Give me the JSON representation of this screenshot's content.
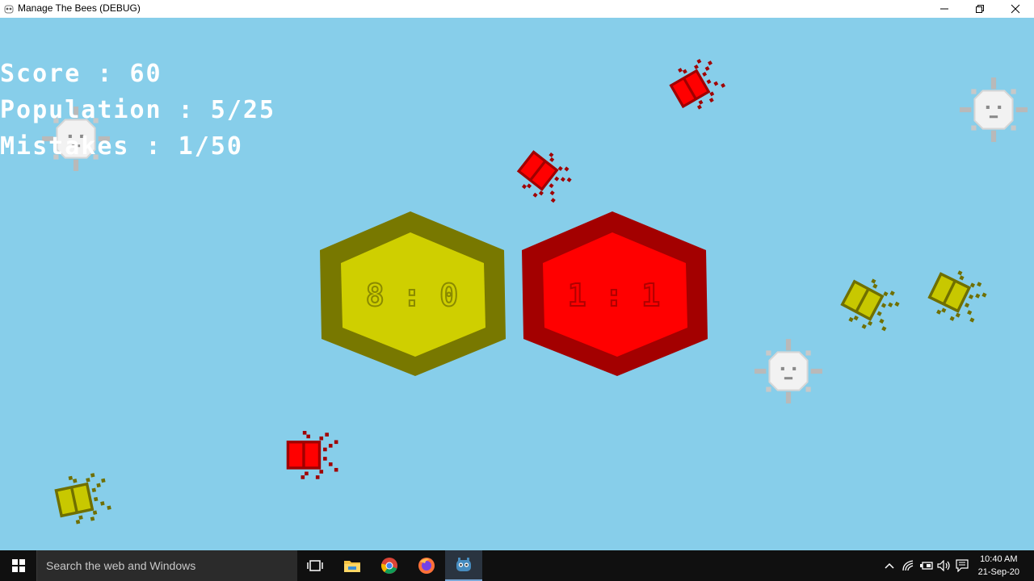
{
  "window": {
    "title": "Manage The Bees (DEBUG)",
    "app_icon": "godot-icon",
    "controls": [
      "minimize-icon",
      "restore-icon",
      "close-icon"
    ]
  },
  "hud": {
    "score": "Score : 60",
    "population": "Population : 5/25",
    "mistakes": "Mistakes : 1/50"
  },
  "hives": [
    {
      "color": "yellow",
      "label": "8 : 0",
      "outer": "#787800",
      "inner": "#cfcf00",
      "text": "#8a8a00"
    },
    {
      "color": "red",
      "label": "1 : 1",
      "outer": "#a30000",
      "inner": "#ff0000",
      "text": "#b00000"
    }
  ],
  "bee_colors": {
    "red": "#ff0000",
    "red_dark": "#a00000",
    "yellow": "#c8c800",
    "yellow_dark": "#6f6f00"
  },
  "taskbar": {
    "search_placeholder": "Search the web and Windows",
    "apps": [
      "task-view-icon",
      "file-explorer-icon",
      "chrome-icon",
      "firefox-icon",
      "godot-icon"
    ],
    "tray_icons": [
      "chevron-up-icon",
      "wifi-icon",
      "battery-icon",
      "volume-icon",
      "notification-icon"
    ],
    "time": "10:40 AM",
    "date": "21-Sep-20"
  }
}
